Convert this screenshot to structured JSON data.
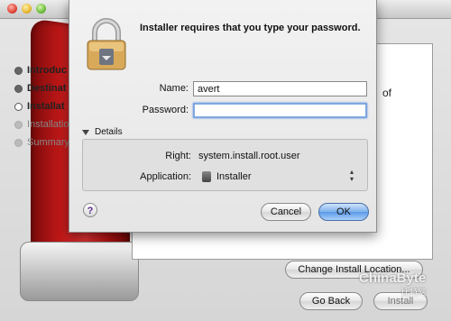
{
  "background_installer": {
    "steps": [
      {
        "label": "Introduc",
        "state": "done"
      },
      {
        "label": "Destinat",
        "state": "done"
      },
      {
        "label": "Installat",
        "state": "current"
      },
      {
        "label": "Installatio",
        "state": "future"
      },
      {
        "label": "Summary",
        "state": "future"
      }
    ],
    "pane_text_fragment": "of",
    "change_location_label": "Change Install Location...",
    "go_back_label": "Go Back",
    "install_label": "Install"
  },
  "auth_dialog": {
    "prompt": "Installer requires that you type your password.",
    "name_label": "Name:",
    "name_value": "avert",
    "password_label": "Password:",
    "password_value": "",
    "details_label": "Details",
    "details": {
      "right_label": "Right:",
      "right_value": "system.install.root.user",
      "application_label": "Application:",
      "application_value": "Installer"
    },
    "help_label": "?",
    "cancel_label": "Cancel",
    "ok_label": "OK"
  },
  "watermark": {
    "brand": "ChinaByte",
    "sub": "比特网"
  },
  "colors": {
    "ok_accent": "#5c9ae6",
    "focus_ring": "#7fa7e0",
    "disk_red": "#c01818"
  },
  "icons": [
    "lock-icon",
    "disk-icon",
    "installer-app-icon",
    "disclosure-triangle-icon",
    "help-icon"
  ]
}
